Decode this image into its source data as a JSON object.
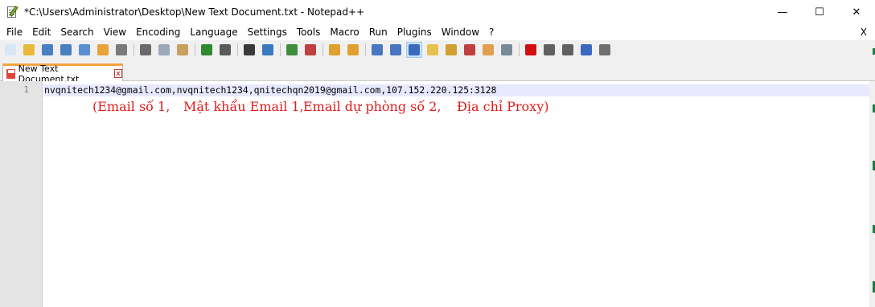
{
  "window": {
    "title": "*C:\\Users\\Administrator\\Desktop\\New Text Document.txt - Notepad++",
    "minimize_glyph": "—",
    "maximize_glyph": "☐",
    "close_glyph": "✕"
  },
  "menu": {
    "items": [
      "File",
      "Edit",
      "Search",
      "View",
      "Encoding",
      "Language",
      "Settings",
      "Tools",
      "Macro",
      "Run",
      "Plugins",
      "Window",
      "?"
    ],
    "close_label": "X"
  },
  "toolbar": {
    "buttons": [
      {
        "icon": "new-file-icon",
        "color": "#d9e7f5"
      },
      {
        "icon": "open-file-icon",
        "color": "#e8b93a"
      },
      {
        "icon": "save-icon",
        "color": "#4a7fc1"
      },
      {
        "icon": "save-all-icon",
        "color": "#4a7fc1"
      },
      {
        "icon": "close-file-icon",
        "color": "#5a8fd0"
      },
      {
        "icon": "close-all-icon",
        "color": "#e8a33a"
      },
      {
        "icon": "print-icon",
        "color": "#7a7a7a"
      },
      {
        "sep": true
      },
      {
        "icon": "cut-icon",
        "color": "#6a6a6a"
      },
      {
        "icon": "copy-icon",
        "color": "#9aa8b8"
      },
      {
        "icon": "paste-icon",
        "color": "#c8a060"
      },
      {
        "sep": true
      },
      {
        "icon": "undo-icon",
        "color": "#2f8a2f"
      },
      {
        "icon": "redo-icon",
        "color": "#5a5a5a"
      },
      {
        "sep": true
      },
      {
        "icon": "find-icon",
        "color": "#3a3a3a"
      },
      {
        "icon": "replace-icon",
        "color": "#3a78c0"
      },
      {
        "sep": true
      },
      {
        "icon": "zoom-in-icon",
        "color": "#3e8e3e"
      },
      {
        "icon": "zoom-out-icon",
        "color": "#c04040"
      },
      {
        "sep": true
      },
      {
        "icon": "sync-vertical-icon",
        "color": "#e0a030"
      },
      {
        "icon": "sync-horizontal-icon",
        "color": "#e0a030"
      },
      {
        "sep": true
      },
      {
        "icon": "word-wrap-icon",
        "color": "#4a78c0"
      },
      {
        "icon": "show-all-chars-icon",
        "color": "#4a78c0"
      },
      {
        "icon": "indent-guide-icon",
        "color": "#3a6ac0",
        "active": true
      },
      {
        "icon": "user-lang-icon",
        "color": "#e8c050"
      },
      {
        "icon": "doc-map-icon",
        "color": "#d0a030"
      },
      {
        "icon": "function-list-icon",
        "color": "#c04040"
      },
      {
        "icon": "folder-workspace-icon",
        "color": "#e0a050"
      },
      {
        "icon": "monitoring-icon",
        "color": "#7a8a9a"
      },
      {
        "sep": true
      },
      {
        "icon": "record-macro-icon",
        "color": "#d01010"
      },
      {
        "icon": "stop-record-icon",
        "color": "#606060"
      },
      {
        "icon": "play-macro-icon",
        "color": "#606060"
      },
      {
        "icon": "run-macro-multiple-icon",
        "color": "#3a6ac0"
      },
      {
        "icon": "save-macro-icon",
        "color": "#707070"
      }
    ]
  },
  "tabs": [
    {
      "label": "New Text Document.txt",
      "close_glyph": "x"
    }
  ],
  "editor": {
    "line_number": "1",
    "line_text": "nvqnitech1234@gmail.com,nvqnitech1234,qnitechqn2019@gmail.com,107.152.220.125:3128",
    "annotations": [
      {
        "text": "(Email số 1,"
      },
      {
        "text": "Mật khẩu Email 1,"
      },
      {
        "text": "Email dự phòng số 2,"
      },
      {
        "text": "Địa chỉ Proxy)"
      }
    ]
  },
  "colors": {
    "annotation": "#e11b1b",
    "current_line": "#e8e8ff",
    "tab_accent": "#f7a33f",
    "gutter": "#e4e4e4"
  }
}
